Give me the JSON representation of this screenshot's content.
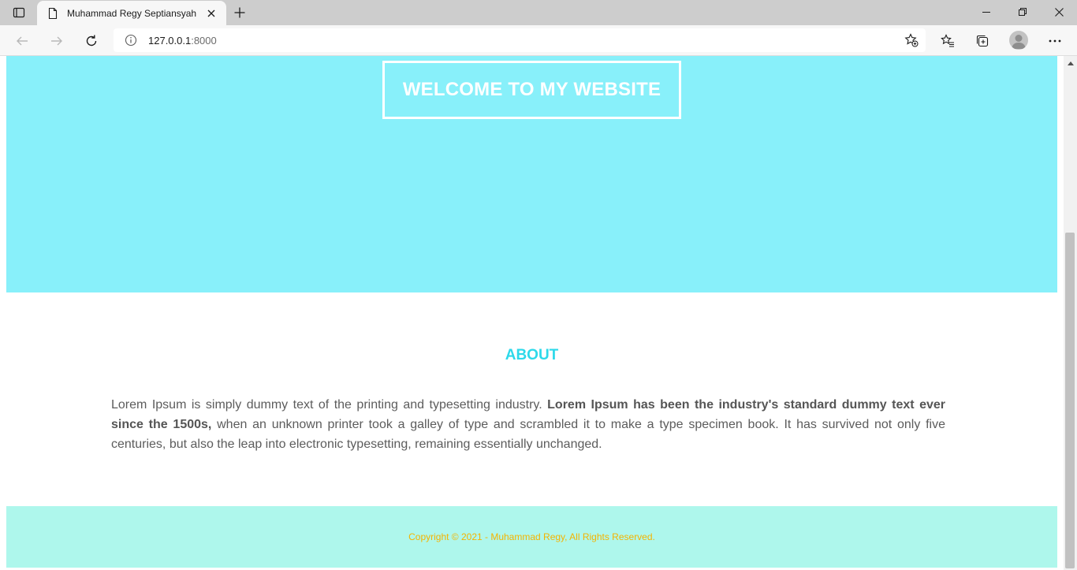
{
  "browser": {
    "tab_title": "Muhammad Regy Septiansyah",
    "url_host": "127.0.0.1",
    "url_port": ":8000",
    "icons": {
      "tab_actions": "tab-actions-icon",
      "page": "page-icon",
      "close": "close-icon",
      "new_tab": "plus-icon",
      "back": "back-arrow-icon",
      "forward": "forward-arrow-icon",
      "refresh": "refresh-icon",
      "info": "info-icon",
      "add_favorite": "star-plus-icon",
      "favorites": "favorites-icon",
      "collections": "collections-icon",
      "profile": "profile-avatar",
      "more": "more-icon",
      "minimize": "minimize-icon",
      "restore": "restore-icon",
      "window_close": "window-close-icon"
    }
  },
  "hero": {
    "welcome": "WELCOME TO MY WEBSITE",
    "background": "#88f0fa"
  },
  "about": {
    "title": "ABOUT",
    "title_color": "#2dd9ea",
    "text_start": "Lorem Ipsum is simply dummy text of the printing and typesetting industry. ",
    "text_bold": "Lorem Ipsum has been the industry's standard dummy text ever since the 1500s,",
    "text_end": " when an unknown printer took a galley of type and scrambled it to make a type specimen book. It has survived not only five centuries, but also the leap into electronic typesetting, remaining essentially unchanged."
  },
  "footer": {
    "copyright": "Copyright © 2021 - Muhammad Regy, All Rights Reserved.",
    "background": "#aef7ec",
    "text_color": "#f4b400"
  }
}
